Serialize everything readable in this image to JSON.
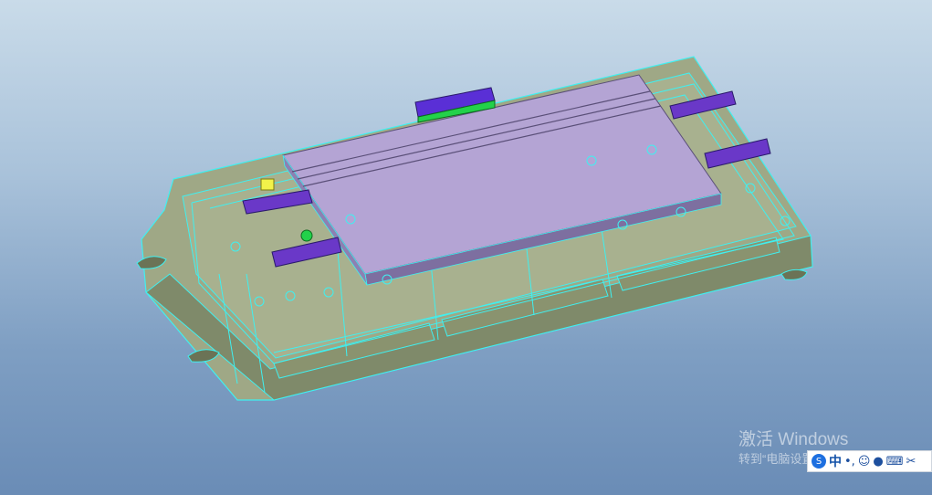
{
  "watermark": {
    "title": "激活 Windows",
    "subtitle": "转到“电脑设置”以激活 Windows。"
  },
  "ime_toolbar": {
    "logo": "S",
    "language": "中",
    "punctuation": "•,",
    "emoji": "☺",
    "voice": "●",
    "keyboard": "⌨",
    "tools": "✂"
  },
  "colors": {
    "background_top": "#c9dbe9",
    "background_bottom": "#6a8cb6",
    "base_plate": "#9fa886",
    "wireframe": "#3ff0f0",
    "rail": "#b4a4d4",
    "clamp": "#6a38c8",
    "accent_green": "#2bd84a",
    "accent_yellow": "#f2f24a"
  }
}
